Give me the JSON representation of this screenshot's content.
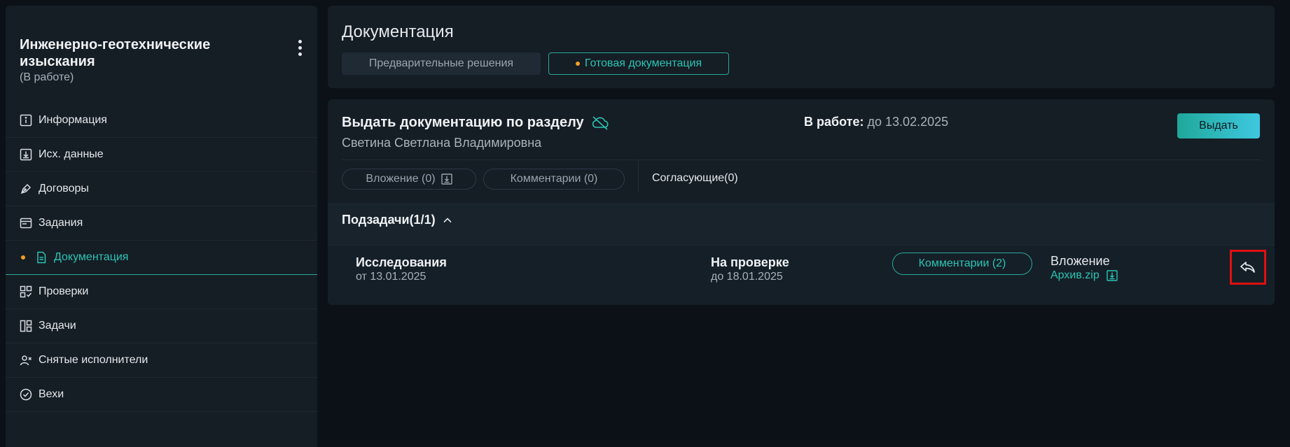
{
  "sidebar": {
    "project_title": "Инженерно-геотехнические изыскания",
    "project_status": "(В работе)",
    "items": [
      {
        "label": "Информация",
        "icon": "info-icon"
      },
      {
        "label": "Исх. данные",
        "icon": "download-box-icon"
      },
      {
        "label": "Договоры",
        "icon": "pen-icon"
      },
      {
        "label": "Задания",
        "icon": "window-icon"
      },
      {
        "label": "Документация",
        "icon": "document-icon",
        "active": true
      },
      {
        "label": "Проверки",
        "icon": "grid-check-icon"
      },
      {
        "label": "Задачи",
        "icon": "board-icon"
      },
      {
        "label": "Снятые исполнители",
        "icon": "user-remove-icon"
      },
      {
        "label": "Вехи",
        "icon": "check-circle-icon"
      }
    ]
  },
  "header": {
    "title": "Документация",
    "tabs": [
      {
        "label": "Предварительные решения"
      },
      {
        "label": "Готовая документация",
        "active": true
      }
    ]
  },
  "task": {
    "title": "Выдать документацию по разделу",
    "person": "Светина Светлана Владимировна",
    "status_label": "В работе:",
    "status_value": "до 13.02.2025",
    "issue_button": "Выдать",
    "attachments_pill": "Вложение (0)",
    "comments_pill": "Комментарии (0)",
    "approvers": "Согласующие(0)",
    "subtasks_header": "Подзадачи(1/1)",
    "subtasks": [
      {
        "name": "Исследования",
        "from": "от 13.01.2025",
        "status": "На проверке",
        "due": "до 18.01.2025",
        "comments": "Комментарии (2)",
        "attachment_label": "Вложение",
        "attachment_file": "Архив.zip"
      }
    ]
  },
  "colors": {
    "accent": "#2bc5b3",
    "dot": "#f0a020",
    "background": "#0b1117",
    "panel": "#151d25",
    "highlight": "#e01010"
  }
}
